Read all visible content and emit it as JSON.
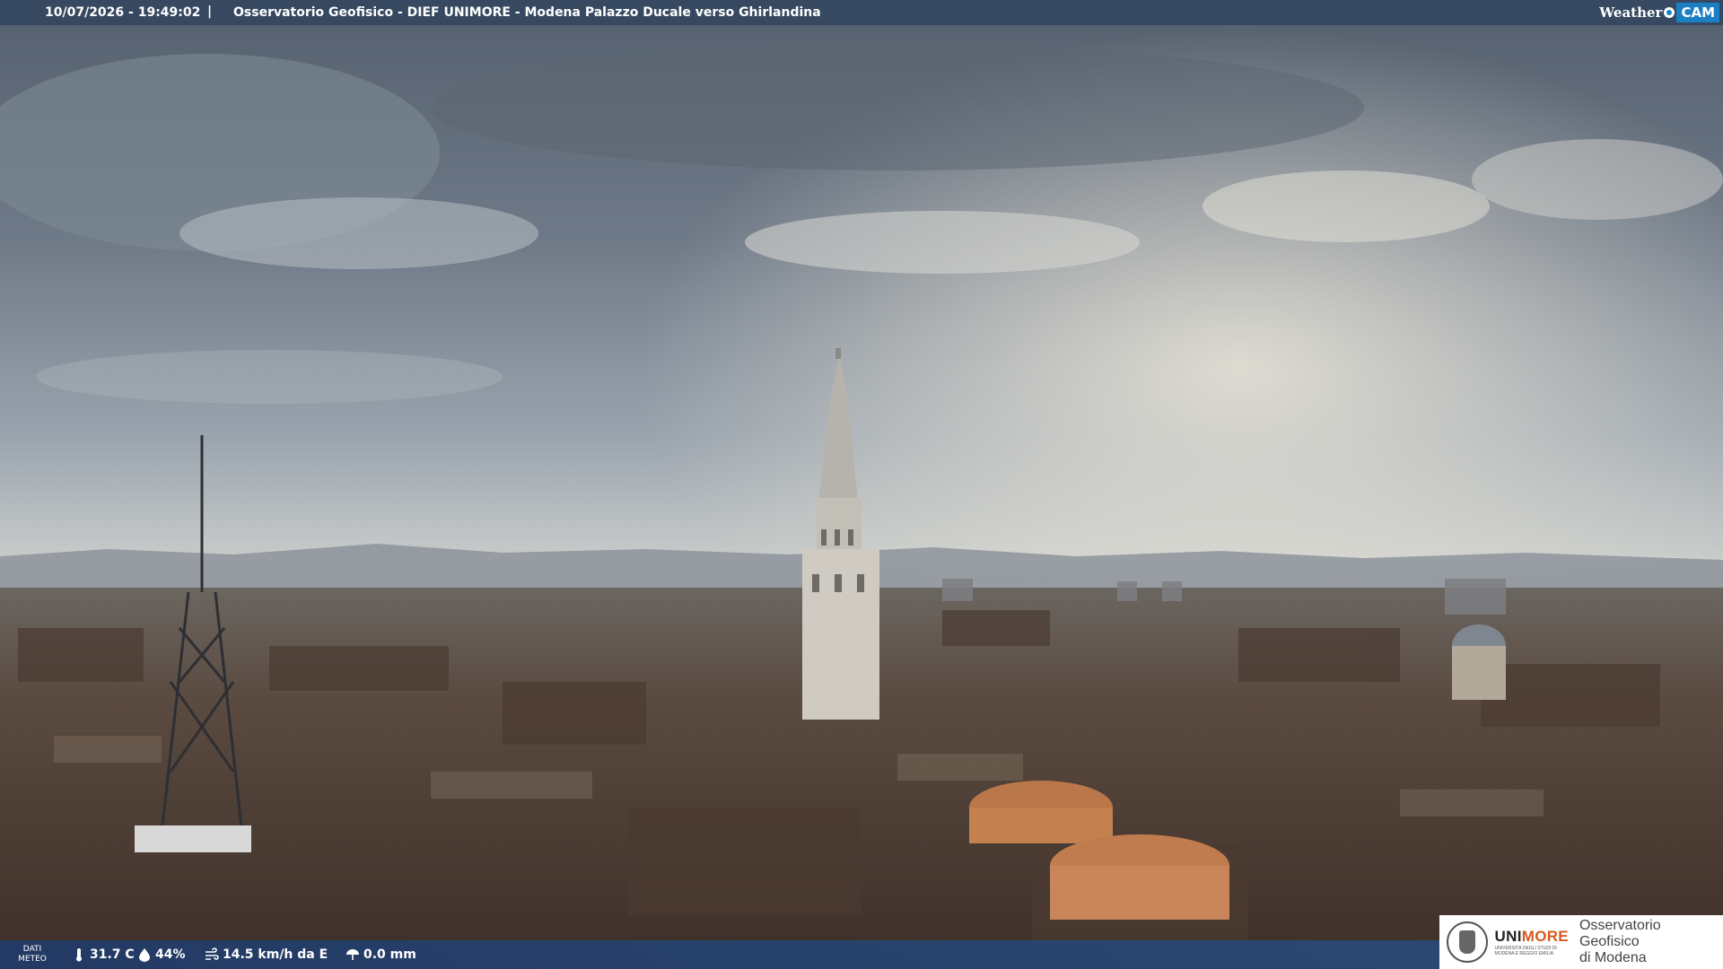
{
  "header": {
    "datetime": "10/07/2026 - 19:49:02",
    "separator": "|",
    "title": "Osservatorio Geofisico - DIEF UNIMORE - Modena Palazzo Ducale verso Ghirlandina",
    "logo_word": "Weather",
    "logo_cam": "CAM"
  },
  "meteo": {
    "dati_line1": "DATI",
    "dati_line2": "METEO",
    "temperature": "31.7 C",
    "humidity": "44%",
    "wind": "14.5 km/h da E",
    "rain": "0.0 mm",
    "icons": [
      "thermometer-icon",
      "humidity-icon",
      "wind-icon",
      "rain-icon"
    ]
  },
  "branding": {
    "uni_prefix": "UNI",
    "uni_suffix": "MORE",
    "uni_subtitle": "UNIVERSITÀ DEGLI STUDI DI MODENA E REGGIO EMILIA",
    "obs_line1": "Osservatorio Geofisico",
    "obs_line2": "di Modena",
    "accent_color": "#d85a1e"
  }
}
